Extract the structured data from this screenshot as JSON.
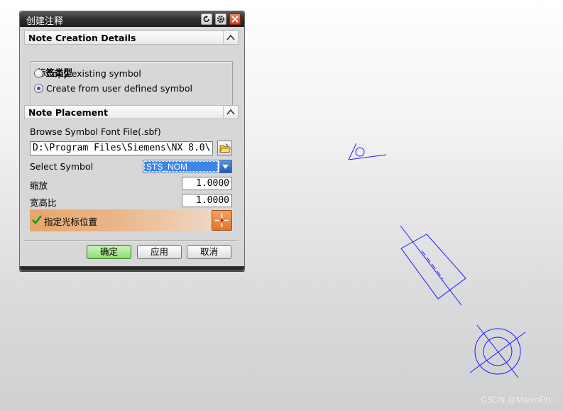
{
  "window": {
    "title": "创建注释",
    "buttons": [
      "reset-icon",
      "settings-icon",
      "close-icon"
    ]
  },
  "note_creation": {
    "header": "Note Creation Details",
    "group_title": "标签类型",
    "options": [
      {
        "label": "Copy existing symbol",
        "selected": false
      },
      {
        "label": "Create from user defined symbol",
        "selected": true
      }
    ]
  },
  "note_placement": {
    "header": "Note Placement",
    "browse_label": "Browse Symbol Font File(.sbf)",
    "path_value": "D:\\Program Files\\Siemens\\NX 8.0\\",
    "select_label": "Select Symbol",
    "select_value": "STS_NOM",
    "scale_label": "缩放",
    "scale_value": "1.0000",
    "aspect_label": "宽高比",
    "aspect_value": "1.0000",
    "cursor_label": "指定光标位置"
  },
  "footer": {
    "ok": "确定",
    "apply": "应用",
    "cancel": "取消"
  },
  "watermark": "CSDN @MarcoPro",
  "colors": {
    "geometry": "#1a1aff",
    "title_bar": "#2e2e2e",
    "ok_button": "#8fdc73",
    "cursor_bar": "#e6a66c",
    "selection": "#3d86e8"
  }
}
